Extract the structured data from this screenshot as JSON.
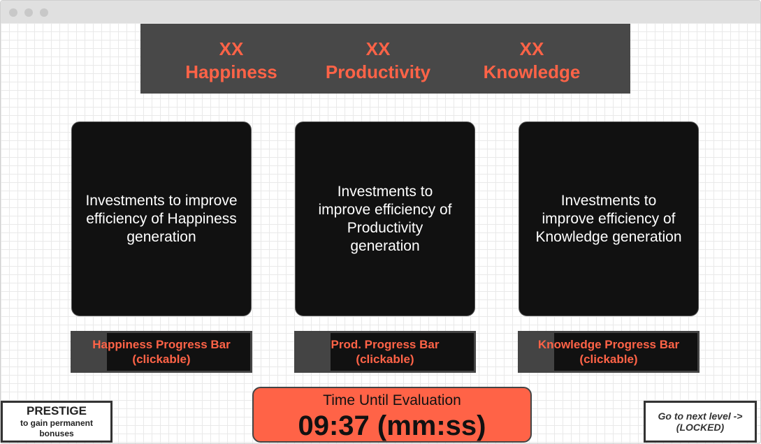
{
  "stats": [
    {
      "value": "XX",
      "label": "Happiness"
    },
    {
      "value": "XX",
      "label": "Productivity"
    },
    {
      "value": "XX",
      "label": "Knowledge"
    }
  ],
  "cards": [
    {
      "text": "Investments to improve efficiency of Happiness generation"
    },
    {
      "text": "Investments to improve efficiency of Productivity generation"
    },
    {
      "text": "Investments to improve efficiency of Knowledge generation"
    }
  ],
  "progress_bars": [
    {
      "label": "Happiness Progress Bar (clickable)"
    },
    {
      "label": "Prod. Progress Bar (clickable)"
    },
    {
      "label": "Knowledge Progress Bar (clickable)"
    }
  ],
  "timer": {
    "title": "Time Until Evaluation",
    "value": "09:37 (mm:ss)"
  },
  "prestige": {
    "title": "PRESTIGE",
    "subtitle": "to gain permanent bonuses"
  },
  "next_level": {
    "label": "Go to next level -> (LOCKED)"
  },
  "colors": {
    "accent": "#ff6347",
    "panel": "#484848",
    "card": "#111111"
  }
}
